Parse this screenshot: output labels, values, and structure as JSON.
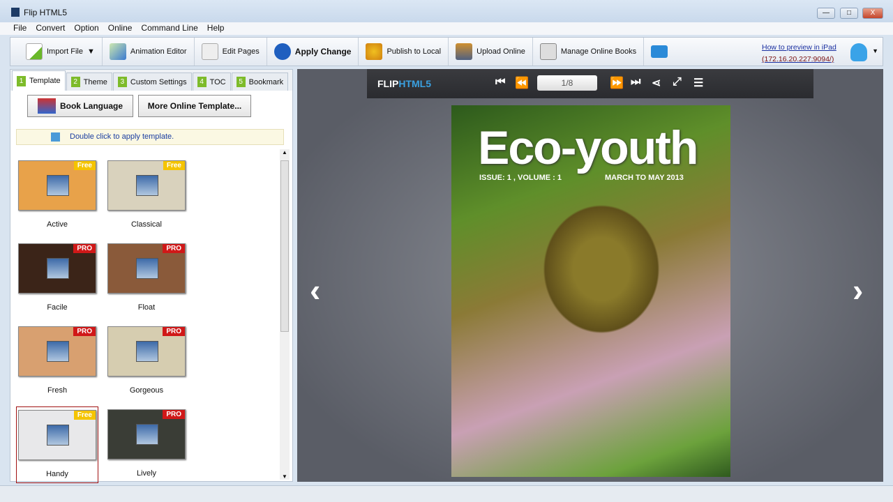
{
  "window": {
    "title": "Flip HTML5",
    "minimize": "—",
    "maximize": "□",
    "close": "X"
  },
  "menu": [
    "File",
    "Convert",
    "Option",
    "Online",
    "Command Line",
    "Help"
  ],
  "toolbar": {
    "import": "Import File",
    "animation": "Animation Editor",
    "edit": "Edit Pages",
    "apply": "Apply Change",
    "publish": "Publish to Local",
    "upload": "Upload Online",
    "manage": "Manage Online Books",
    "preview_link": "How to preview in iPad",
    "preview_ip": "(172.16.20.227:9094/)"
  },
  "tabs": [
    {
      "num": "1",
      "label": "Template"
    },
    {
      "num": "2",
      "label": "Theme"
    },
    {
      "num": "3",
      "label": "Custom Settings"
    },
    {
      "num": "4",
      "label": "TOC"
    },
    {
      "num": "5",
      "label": "Bookmark"
    }
  ],
  "buttons": {
    "language": "Book Language",
    "more": "More Online Template..."
  },
  "hint": "Double click to apply template.",
  "templates": [
    {
      "name": "Active",
      "badge": "Free",
      "color": "#e8a24a"
    },
    {
      "name": "Classical",
      "badge": "Free",
      "color": "#d9d2bd"
    },
    {
      "name": "Facile",
      "badge": "PRO",
      "color": "#3b2418"
    },
    {
      "name": "Float",
      "badge": "PRO",
      "color": "#8a5a3a"
    },
    {
      "name": "Fresh",
      "badge": "PRO",
      "color": "#d8a070"
    },
    {
      "name": "Gorgeous",
      "badge": "PRO",
      "color": "#d6cdb0"
    },
    {
      "name": "Handy",
      "badge": "Free",
      "color": "#e8e8ea"
    },
    {
      "name": "Lively",
      "badge": "PRO",
      "color": "#3a3d36"
    }
  ],
  "viewer": {
    "logo_a": "FLIP",
    "logo_b": "HTML5",
    "page": "1/8",
    "book_title": "Eco-youth",
    "issue": "ISSUE: 1 , VOLUME : 1",
    "date": "MARCH TO MAY 2013"
  }
}
